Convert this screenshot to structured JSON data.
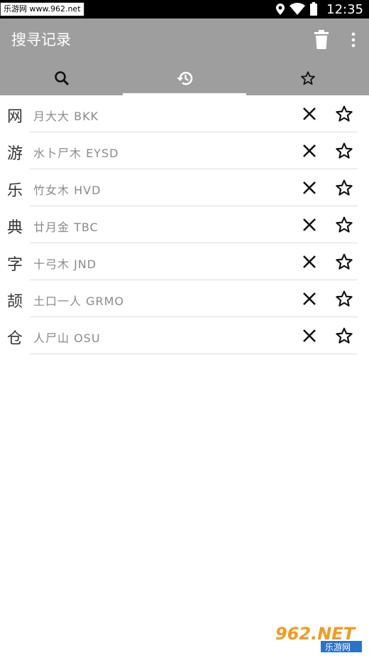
{
  "status_bar": {
    "watermark": "乐游网 www.962.net",
    "time": "12:35"
  },
  "app_bar": {
    "title": "搜寻记录",
    "actions": [
      "trash-icon",
      "more-vert-icon"
    ]
  },
  "tabs": [
    {
      "icon": "search-icon",
      "selected": false
    },
    {
      "icon": "history-icon",
      "selected": true
    },
    {
      "icon": "star-outline-icon",
      "selected": false
    }
  ],
  "history": [
    {
      "char": "网",
      "code": "月大大  BKK"
    },
    {
      "char": "游",
      "code": "水卜尸木  EYSD"
    },
    {
      "char": "乐",
      "code": "竹女木  HVD"
    },
    {
      "char": "典",
      "code": "廿月金  TBC"
    },
    {
      "char": "字",
      "code": "十弓木  JND"
    },
    {
      "char": "颉",
      "code": "土口一人  GRMO"
    },
    {
      "char": "仓",
      "code": "人尸山  OSU"
    }
  ],
  "watermark_bottom": {
    "logo_text": "962.NET",
    "sub_text": "乐游网"
  },
  "colors": {
    "appbar": "#9e9e9e",
    "indicator": "#ffffff",
    "divider": "#dcdcdc"
  }
}
